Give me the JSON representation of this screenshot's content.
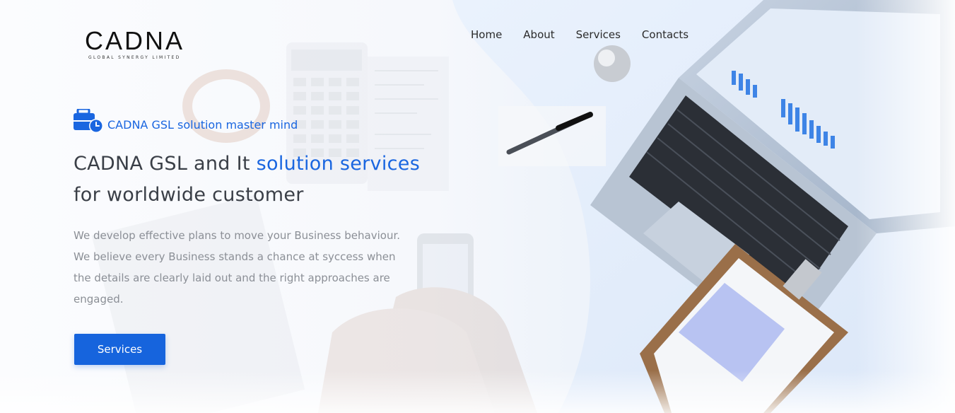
{
  "brand": {
    "name": "CADNA",
    "subtitle": "GLOBAL SYNERGY LIMITED"
  },
  "nav": {
    "items": [
      "Home",
      "About",
      "Services",
      "Contacts"
    ]
  },
  "hero": {
    "tagline": "CADNA GSL solution master mind",
    "tagline_icon": "briefcase-clock-icon",
    "headline_part1": "CADNA GSL and It",
    "headline_accent": "solution services",
    "headline_part2": "for worldwide customer",
    "description": "We develop effective plans to move your Business behaviour. We believe every Business stands a chance at syccess when the details are clearly laid out and the right approaches are engaged.",
    "cta_label": "Services"
  },
  "colors": {
    "accent": "#1a66e0",
    "button": "#1664dd",
    "heading": "#3a3f47",
    "body_text": "#8b8f96"
  }
}
